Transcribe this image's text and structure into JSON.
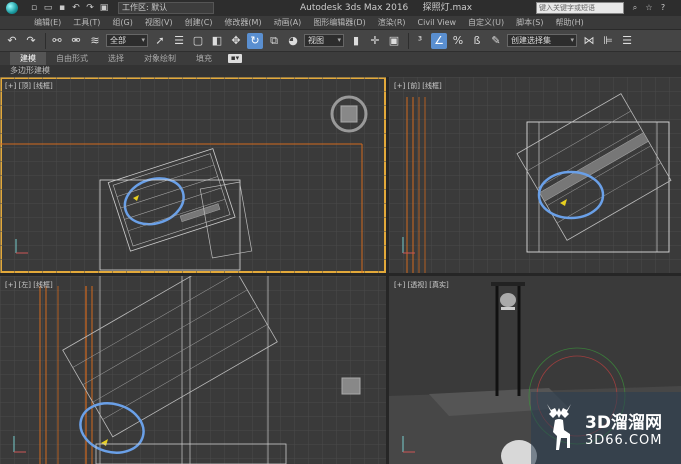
{
  "app": {
    "window_title": "Autodesk 3ds Max 2016",
    "file_name": "探照灯.max",
    "workspace": "工作区: 默认",
    "search_placeholder": "键入关键字或短语"
  },
  "menu": {
    "items": [
      "编辑(E)",
      "工具(T)",
      "组(G)",
      "视图(V)",
      "创建(C)",
      "修改器(M)",
      "动画(A)",
      "图形编辑器(D)",
      "渲染(R)",
      "Civil View",
      "自定义(U)",
      "脚本(S)",
      "帮助(H)"
    ]
  },
  "toolbar": {
    "selection_filter": "全部",
    "reference_coord": "视图",
    "named_selection": "创建选择集",
    "icons": [
      "undo-icon",
      "redo-icon",
      "link-icon",
      "unlink-icon",
      "bind-spacewarp-icon",
      "select-icon",
      "select-by-name-icon",
      "rect-region-icon",
      "window-crossing-icon",
      "move-icon",
      "rotate-icon",
      "scale-icon",
      "pivot-icon",
      "snap-icon",
      "angle-snap-icon",
      "percent-snap-icon",
      "spinner-snap-icon",
      "edit-named-selection-icon",
      "mirror-icon",
      "align-icon"
    ]
  },
  "ribbon": {
    "tabs": [
      "建模",
      "自由形式",
      "选择",
      "对象绘制",
      "填充"
    ],
    "active_tab": "建模",
    "sub_label": "多边形建模"
  },
  "viewports": {
    "top_left": "[+] [顶] [线框]",
    "top_right": "[+] [前] [线框]",
    "bottom_left": "[+] [左] [线框]",
    "bottom_right": "[+] [透视] [真实]"
  },
  "watermark": {
    "brand": "3D溜溜网",
    "url": "3D66.COM"
  },
  "colors": {
    "active_border": "#e3a93a",
    "selection_blue": "#6aa0e8",
    "viewport_bg": "#3a3a3a",
    "grid": "#4a4a4a",
    "wire": "#d8d8d8",
    "orange_lines": "#d2691e"
  }
}
